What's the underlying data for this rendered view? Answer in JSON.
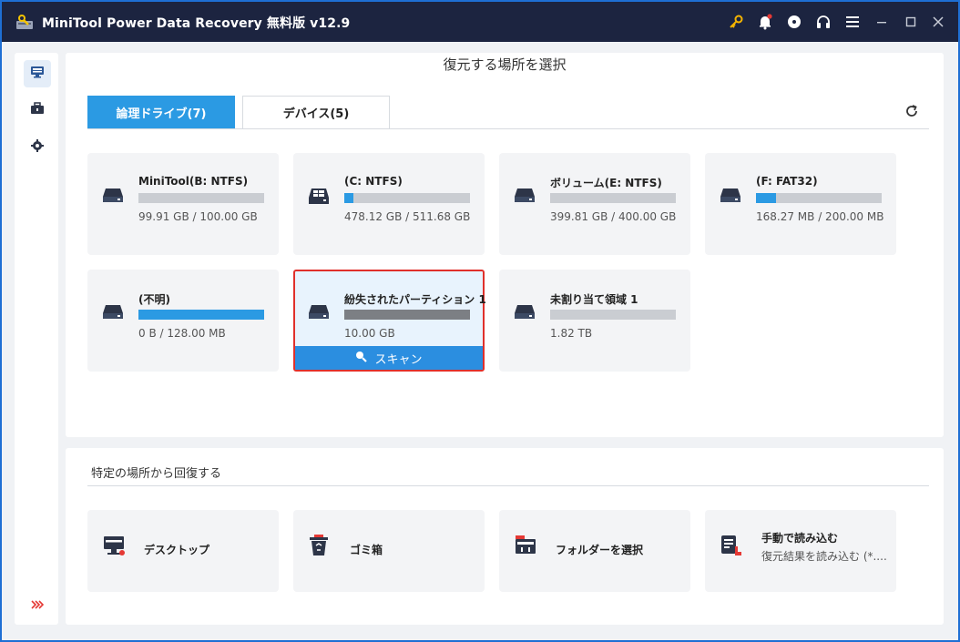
{
  "app": {
    "title": "MiniTool Power Data Recovery 無料版 v12.9"
  },
  "titlebar_icons": [
    "key-icon",
    "bell-icon",
    "disc-icon",
    "headset-icon",
    "menu-icon",
    "minimize-icon",
    "maximize-icon",
    "close-icon"
  ],
  "sidebar": {
    "items": [
      {
        "icon": "computer-icon",
        "active": true
      },
      {
        "icon": "toolbox-icon",
        "active": false
      },
      {
        "icon": "settings-icon",
        "active": false
      }
    ],
    "expand_icon": "double-chevron-right-icon"
  },
  "main": {
    "page_title": "復元する場所を選択",
    "tabs": [
      {
        "label": "論理ドライブ(7)",
        "active": true
      },
      {
        "label": "デバイス(5)",
        "active": false
      }
    ],
    "drives": [
      {
        "name": "MiniTool(B: NTFS)",
        "size": "99.91 GB / 100.00 GB",
        "fill": 0.0,
        "icon": "drive-icon"
      },
      {
        "name": "(C: NTFS)",
        "size": "478.12 GB / 511.68 GB",
        "fill": 0.07,
        "icon": "windows-drive-icon"
      },
      {
        "name": "ボリューム(E: NTFS)",
        "size": "399.81 GB / 400.00 GB",
        "fill": 0.0,
        "icon": "drive-icon"
      },
      {
        "name": "(F: FAT32)",
        "size": "168.27 MB / 200.00 MB",
        "fill": 0.16,
        "icon": "drive-icon"
      },
      {
        "name": "(不明)",
        "size": "0 B / 128.00 MB",
        "fill": 1.0,
        "icon": "drive-icon"
      },
      {
        "name": "紛失されたパーティション 1",
        "size": "10.00 GB",
        "fill": 0.0,
        "icon": "drive-icon",
        "selected": true
      },
      {
        "name": "未割り当て領域 1",
        "size": "1.82 TB",
        "fill": 0.0,
        "icon": "drive-icon"
      }
    ],
    "scan_label": "スキャン"
  },
  "recover_from": {
    "title": "特定の場所から回復する",
    "items": [
      {
        "label": "デスクトップ",
        "icon": "desktop-icon"
      },
      {
        "label": "ゴミ箱",
        "icon": "recycle-bin-icon"
      },
      {
        "label": "フォルダーを選択",
        "icon": "folder-icon"
      },
      {
        "label": "手動で読み込む",
        "sub": "復元結果を読み込む (*....",
        "icon": "load-file-icon"
      }
    ]
  },
  "colors": {
    "accent": "#2b9ae3",
    "titlebar": "#1c2440",
    "selected_border": "#e0302b",
    "key_icon": "#f5b400",
    "notification_dot": "#e53935"
  }
}
